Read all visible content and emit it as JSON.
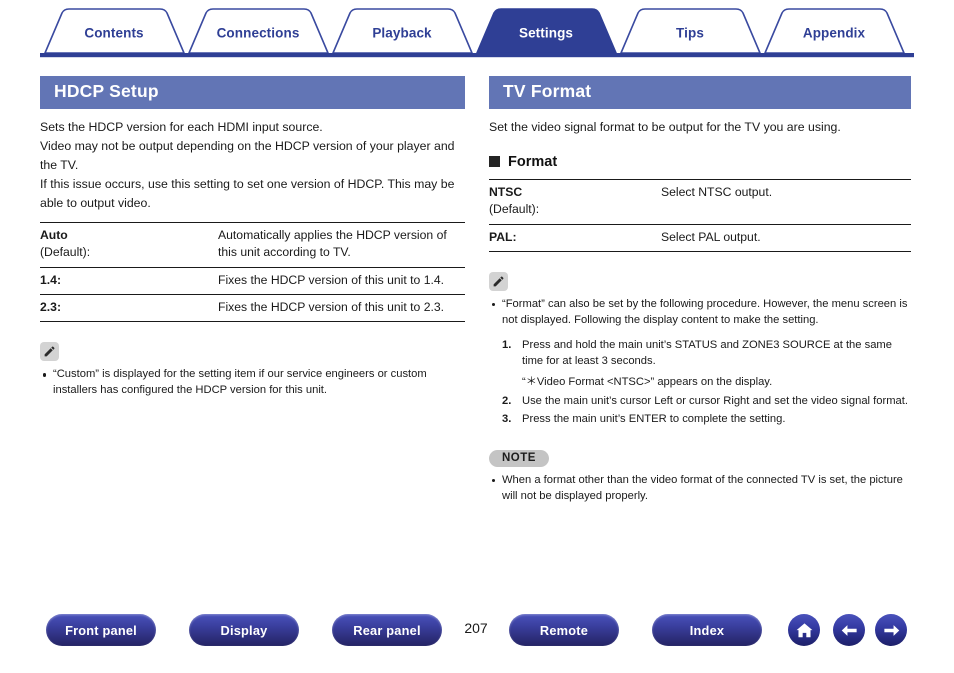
{
  "tabs": [
    {
      "label": "Contents",
      "active": false
    },
    {
      "label": "Connections",
      "active": false
    },
    {
      "label": "Playback",
      "active": false
    },
    {
      "label": "Settings",
      "active": true
    },
    {
      "label": "Tips",
      "active": false
    },
    {
      "label": "Appendix",
      "active": false
    }
  ],
  "colors": {
    "tab_active_bg": "#2f3f95",
    "tab_text": "#2f3f95",
    "section_header_bg": "#6275b5",
    "rule": "#2f3f95",
    "footer_pill": "#343a9e",
    "badge_gray": "#c4c4c4"
  },
  "left": {
    "header": "HDCP Setup",
    "paragraphs": [
      "Sets the HDCP version for each HDMI input source.",
      "Video may not be output depending on the HDCP version of your player and the TV.",
      "If this issue occurs, use this setting to set one version of HDCP. This may be able to output video."
    ],
    "table": [
      {
        "term_main": "Auto",
        "term_sub": "(Default):",
        "desc": "Automatically applies the HDCP version of this unit according to TV."
      },
      {
        "term_main": "1.4:",
        "term_sub": "",
        "desc": "Fixes the HDCP version of this unit to 1.4."
      },
      {
        "term_main": "2.3:",
        "term_sub": "",
        "desc": "Fixes the HDCP version of this unit to 2.3."
      }
    ],
    "note": {
      "icon": "pencil-icon",
      "bullets": [
        "“Custom” is displayed for the setting item if our service engineers or custom installers has configured the HDCP version for this unit."
      ]
    }
  },
  "right": {
    "header": "TV Format",
    "paragraphs": [
      "Set the video signal format to be output for the TV you are using."
    ],
    "sub_heading": "Format",
    "table": [
      {
        "term_main": "NTSC",
        "term_sub": "(Default):",
        "desc": "Select NTSC output."
      },
      {
        "term_main": "PAL:",
        "term_sub": "",
        "desc": "Select PAL output."
      }
    ],
    "tip": {
      "icon": "pencil-icon",
      "bullets": [
        "“Format” can also be set by the following procedure. However, the menu screen is not displayed. Following the display content to make the setting."
      ],
      "steps": [
        "Press and hold the main unit’s STATUS and ZONE3 SOURCE at the same time for at least 3 seconds.",
        "Use the main unit’s cursor Left or cursor Right and set the video signal format.",
        "Press the main unit’s ENTER to complete the setting."
      ],
      "step1_extra": "“＊Video Format <NTSC>” appears on the display."
    },
    "note": {
      "label": "NOTE",
      "bullets": [
        "When a format other than the video format of the connected TV is set, the picture will not be displayed properly."
      ]
    }
  },
  "footer": {
    "buttons": [
      {
        "label": "Front panel"
      },
      {
        "label": "Display"
      },
      {
        "label": "Rear panel"
      },
      {
        "label": "Remote"
      },
      {
        "label": "Index"
      }
    ],
    "page_number": "207",
    "icon_buttons": [
      {
        "name": "home-icon"
      },
      {
        "name": "arrow-left-icon"
      },
      {
        "name": "arrow-right-icon"
      }
    ]
  }
}
